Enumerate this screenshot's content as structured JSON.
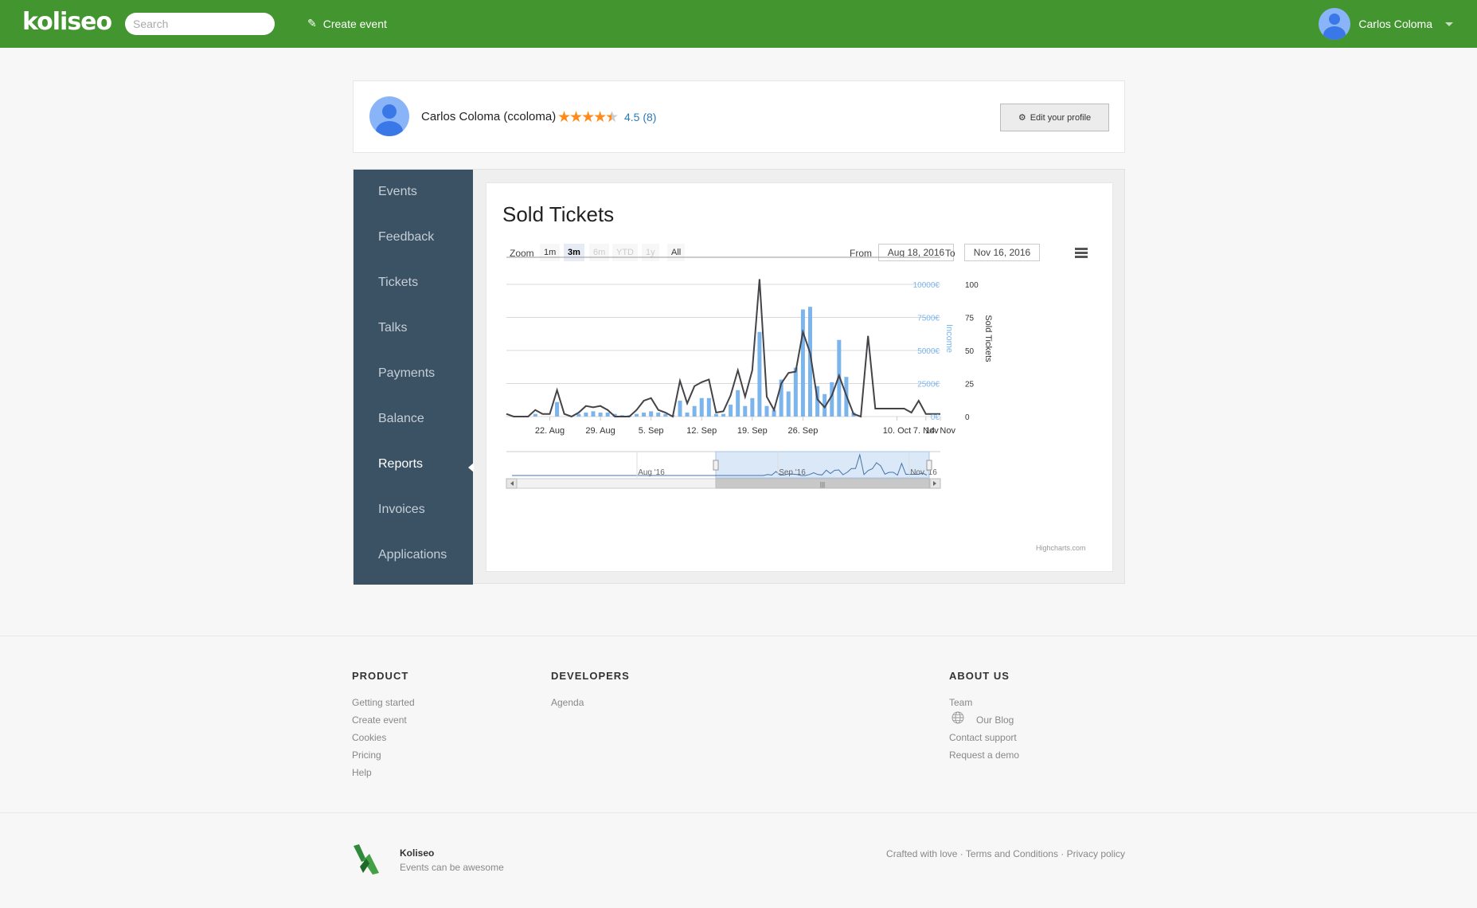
{
  "topbar": {
    "brand": "koliseo",
    "search_placeholder": "Search",
    "create_event": "Create event",
    "user_name": "Carlos Coloma"
  },
  "profile": {
    "name": "Carlos Coloma (ccoloma)",
    "rating": "4.5 (8)",
    "edit_label": "Edit your profile"
  },
  "sidebar": {
    "items": [
      {
        "label": "Events"
      },
      {
        "label": "Feedback"
      },
      {
        "label": "Tickets"
      },
      {
        "label": "Talks"
      },
      {
        "label": "Payments"
      },
      {
        "label": "Balance"
      },
      {
        "label": "Reports"
      },
      {
        "label": "Invoices"
      },
      {
        "label": "Applications"
      }
    ],
    "active": "Reports"
  },
  "chart": {
    "title": "Sold Tickets",
    "zoom_label": "Zoom",
    "zoom_buttons": [
      "1m",
      "3m",
      "6m",
      "YTD",
      "1y",
      "All"
    ],
    "zoom_active": "3m",
    "zoom_disabled": [
      "6m",
      "YTD",
      "1y"
    ],
    "from_label": "From",
    "from_value": "Aug 18, 2016",
    "to_label": "To",
    "to_value": "Nov 16, 2016",
    "credits": "Highcharts.com"
  },
  "chart_data": {
    "type": "line",
    "title": "Sold Tickets",
    "x_tick_labels": [
      "22. Aug",
      "29. Aug",
      "5. Sep",
      "12. Sep",
      "19. Sep",
      "26. Sep",
      "10. Oct",
      "7. Nov",
      "14. Nov"
    ],
    "y_axes": [
      {
        "label": "Income",
        "ticks": [
          "0€",
          "2500€",
          "5000€",
          "7500€",
          "10000€"
        ],
        "range": [
          0,
          10000
        ],
        "color": "#7cb5ec"
      },
      {
        "label": "Sold Tickets",
        "ticks": [
          "0",
          "25",
          "50",
          "75",
          "100"
        ],
        "range": [
          0,
          100
        ],
        "color": "#434348"
      }
    ],
    "series": [
      {
        "name": "Sold Tickets",
        "type": "line",
        "color": "#434348",
        "values": [
          2,
          0,
          0,
          0,
          5,
          2,
          2,
          20,
          2,
          0,
          3,
          8,
          7,
          8,
          5,
          0,
          0,
          0,
          5,
          12,
          14,
          5,
          3,
          0,
          27,
          10,
          23,
          26,
          28,
          3,
          4,
          16,
          35,
          15,
          35,
          104,
          15,
          5,
          25,
          33,
          34,
          64,
          48,
          13,
          7,
          16,
          31,
          16,
          2,
          0,
          61,
          6,
          6,
          6,
          6,
          6,
          3,
          12,
          2,
          2,
          2
        ]
      },
      {
        "name": "Income",
        "type": "bar",
        "color": "#7cb5ec",
        "values": [
          0,
          0,
          0,
          0,
          200,
          0,
          0,
          1100,
          0,
          0,
          200,
          300,
          400,
          300,
          300,
          200,
          100,
          100,
          200,
          300,
          400,
          300,
          200,
          100,
          1200,
          300,
          800,
          1400,
          1400,
          200,
          200,
          900,
          2000,
          800,
          1400,
          6400,
          800,
          500,
          2800,
          1900,
          3700,
          8100,
          8300,
          2300,
          1700,
          2600,
          5800,
          3000,
          300,
          0,
          0,
          0,
          0,
          0,
          0,
          0,
          0,
          0,
          0,
          0,
          0
        ]
      }
    ],
    "navigator": {
      "labels": [
        "Aug '16",
        "Sep '16",
        "Nov '16"
      ]
    },
    "legend": "none",
    "grid": true
  },
  "footer": {
    "product_title": "PRODUCT",
    "product_links": [
      "Getting started",
      "Create event",
      "Cookies",
      "Pricing",
      "Help"
    ],
    "developers_title": "DEVELOPERS",
    "developers_links": [
      "Agenda"
    ],
    "about_title": "ABOUT US",
    "about_links": [
      "Team",
      "Our Blog",
      "Contact support",
      "Request a demo"
    ],
    "brand": "Koliseo",
    "tagline": "Events can be awesome",
    "legal": [
      "Crafted with love",
      "Terms and Conditions",
      "Privacy policy"
    ],
    "legal_separator": "·"
  }
}
